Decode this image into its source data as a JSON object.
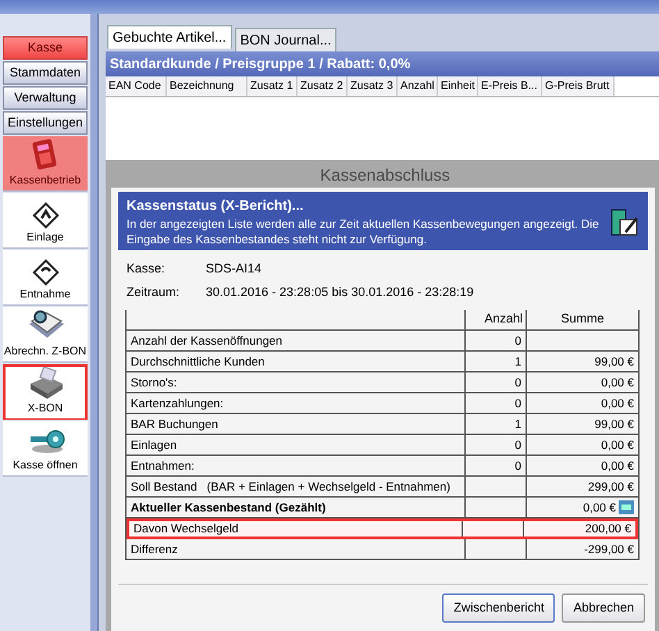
{
  "sidebar": {
    "items": [
      {
        "label": "Kasse",
        "kind": "button",
        "selected": true,
        "highlighted": false
      },
      {
        "label": "Stammdaten",
        "kind": "button",
        "selected": false,
        "highlighted": false
      },
      {
        "label": "Verwaltung",
        "kind": "button",
        "selected": false,
        "highlighted": false
      },
      {
        "label": "Einstellungen",
        "kind": "button",
        "selected": false,
        "highlighted": false
      },
      {
        "label": "Kassenbetrieb",
        "kind": "tile",
        "selected": true,
        "highlighted": false
      },
      {
        "label": "Einlage",
        "kind": "tile",
        "selected": false,
        "highlighted": false
      },
      {
        "label": "Entnahme",
        "kind": "tile",
        "selected": false,
        "highlighted": false
      },
      {
        "label": "Abrechn. Z-BON",
        "kind": "tile",
        "selected": false,
        "highlighted": false
      },
      {
        "label": "X-BON",
        "kind": "tile",
        "selected": false,
        "highlighted": true
      },
      {
        "label": "Kasse öffnen",
        "kind": "tile",
        "selected": false,
        "highlighted": false
      }
    ]
  },
  "tabs": [
    {
      "label": "Gebuchte Artikel...",
      "selected": true
    },
    {
      "label": "BON Journal...",
      "selected": false
    }
  ],
  "customer_bar": "Standardkunde / Preisgruppe 1 / Rabatt: 0,0%",
  "table": {
    "columns": [
      "EAN Code",
      "Bezeichnung",
      "Zusatz 1",
      "Zusatz 2",
      "Zusatz 3",
      "Anzahl",
      "Einheit",
      "E-Preis B...",
      "G-Preis Brutt"
    ]
  },
  "dialog": {
    "title": "Kassenabschluss",
    "banner_title": "Kassenstatus (X-Bericht)...",
    "banner_text": "In der angezeigten Liste werden alle zur Zeit aktuellen Kassenbewegungen angezeigt. Die Eingabe des Kassenbestandes steht nicht zur Verfügung.",
    "fields": [
      {
        "label": "Kasse:",
        "value": "SDS-AI14"
      },
      {
        "label": "Zeitraum:",
        "value": "30.01.2016 - 23:28:05 bis 30.01.2016 - 23:28:19"
      }
    ],
    "columns": [
      "Anzahl",
      "Summe"
    ],
    "rows": [
      {
        "label": "Anzahl der Kassenöffnungen",
        "count": "0",
        "sum": "",
        "bold": false,
        "highlighted": false,
        "editable": false
      },
      {
        "label": "Durchschnittliche Kunden",
        "count": "1",
        "sum": "99,00 €",
        "bold": false,
        "highlighted": false,
        "editable": false
      },
      {
        "label": "Storno's:",
        "count": "0",
        "sum": "0,00 €",
        "bold": false,
        "highlighted": false,
        "editable": false
      },
      {
        "label": "Kartenzahlungen:",
        "count": "0",
        "sum": "0,00 €",
        "bold": false,
        "highlighted": false,
        "editable": false
      },
      {
        "label": "BAR Buchungen",
        "count": "1",
        "sum": "99,00 €",
        "bold": false,
        "highlighted": false,
        "editable": false
      },
      {
        "label": "Einlagen",
        "count": "0",
        "sum": "0,00 €",
        "bold": false,
        "highlighted": false,
        "editable": false
      },
      {
        "label": "Entnahmen:",
        "count": "0",
        "sum": "0,00 €",
        "bold": false,
        "highlighted": false,
        "editable": false
      },
      {
        "label": "Soll Bestand   (BAR + Einlagen + Wechselgeld - Entnahmen)",
        "count": "",
        "sum": "299,00 €",
        "bold": false,
        "highlighted": false,
        "editable": false
      },
      {
        "label": "Aktueller Kassenbestand (Gezählt)",
        "count": "",
        "sum": "0,00 €",
        "bold": true,
        "highlighted": false,
        "editable": true
      },
      {
        "label": "Davon Wechselgeld",
        "count": "",
        "sum": "200,00 €",
        "bold": false,
        "highlighted": true,
        "editable": false
      },
      {
        "label": "Differenz",
        "count": "",
        "sum": "-299,00 €",
        "bold": false,
        "highlighted": false,
        "editable": false
      }
    ],
    "buttons": [
      "Zwischenbericht",
      "Abbrechen"
    ]
  }
}
